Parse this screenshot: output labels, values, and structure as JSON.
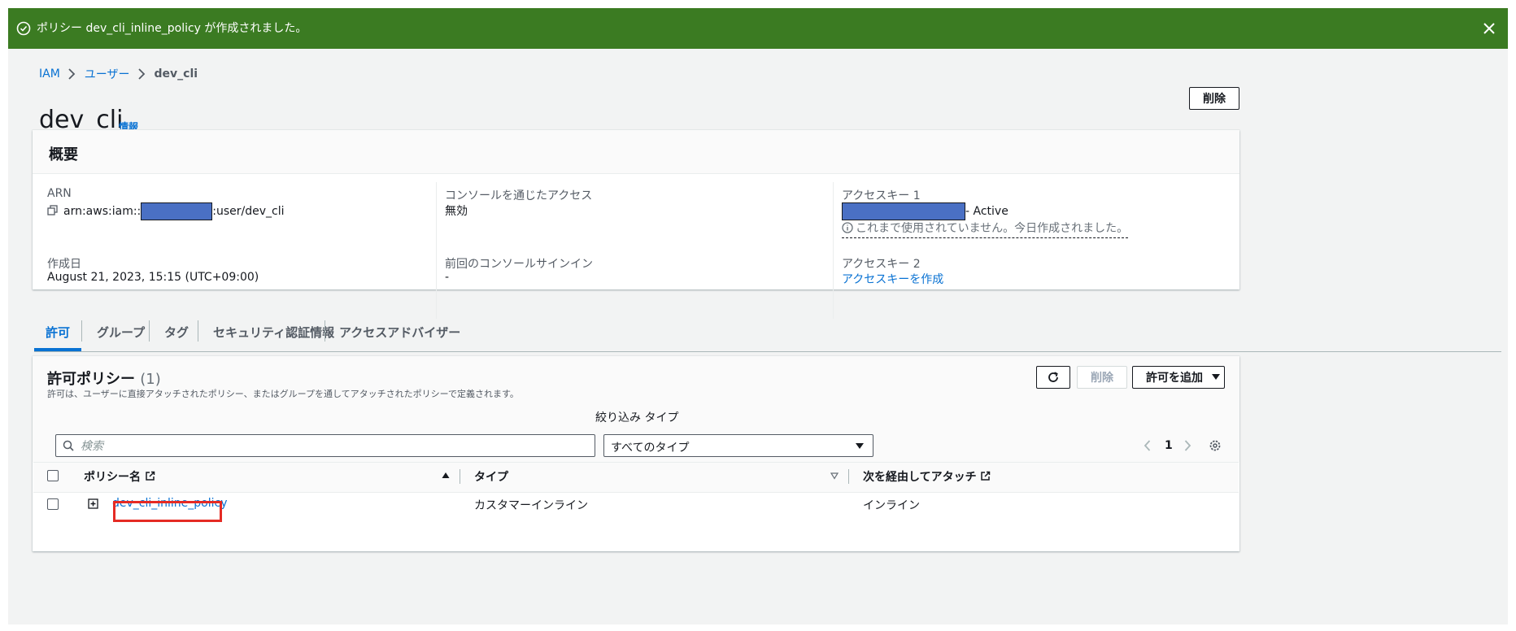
{
  "flash": {
    "message": "ポリシー dev_cli_inline_policy が作成されました。"
  },
  "breadcrumb": {
    "items": [
      "IAM",
      "ユーザー"
    ],
    "current": "dev_cli"
  },
  "page": {
    "title": "dev_cli",
    "info_label": "情報",
    "delete_label": "削除"
  },
  "summary": {
    "title": "概要",
    "arn_label": "ARN",
    "arn_prefix": "arn:aws:iam::",
    "arn_suffix": ":user/dev_cli",
    "created_label": "作成日",
    "created_value": "August 21, 2023, 15:15 (UTC+09:00)",
    "console_access_label": "コンソールを通じたアクセス",
    "console_access_value": "無効",
    "last_signin_label": "前回のコンソールサインイン",
    "last_signin_value": "-",
    "key1_label": "アクセスキー 1",
    "key1_status": "- Active",
    "key1_hint": "これまで使用されていません。今日作成されました。",
    "key2_label": "アクセスキー 2",
    "key2_create_link": "アクセスキーを作成"
  },
  "tabs": [
    {
      "label": "許可",
      "active": true
    },
    {
      "label": "グループ",
      "active": false
    },
    {
      "label": "タグ",
      "active": false
    },
    {
      "label": "セキュリティ認証情報",
      "active": false
    },
    {
      "label": "アクセスアドバイザー",
      "active": false
    }
  ],
  "policies": {
    "title": "許可ポリシー",
    "count": "(1)",
    "description": "許可は、ユーザーに直接アタッチされたポリシー、またはグループを通してアタッチされたポリシーで定義されます。",
    "delete_label": "削除",
    "add_label": "許可を追加",
    "filter_label": "絞り込み タイプ",
    "search_placeholder": "検索",
    "type_select_value": "すべてのタイプ",
    "page_number": "1",
    "columns": [
      "ポリシー名",
      "タイプ",
      "次を経由してアタッチ"
    ],
    "rows": [
      {
        "name": "dev_cli_inline_policy",
        "type": "カスタマーインライン",
        "attached_via": "インライン"
      }
    ]
  },
  "colors": {
    "success": "#3b7b22",
    "link": "#0972d3",
    "highlight": "#e52b24",
    "redaction": "#4a70c4"
  }
}
